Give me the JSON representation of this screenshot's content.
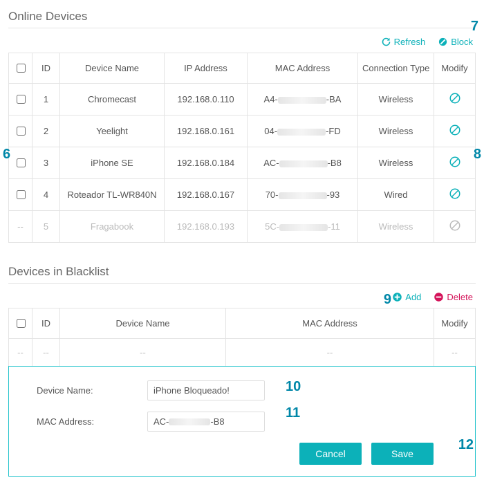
{
  "sections": {
    "online_title": "Online Devices",
    "blacklist_title": "Devices in Blacklist"
  },
  "toolbar_online": {
    "refresh": "Refresh",
    "block": "Block"
  },
  "toolbar_blacklist": {
    "add": "Add",
    "delete": "Delete"
  },
  "online_headers": {
    "id": "ID",
    "name": "Device Name",
    "ip": "IP Address",
    "mac": "MAC Address",
    "conn": "Connection Type",
    "modify": "Modify"
  },
  "online_rows": [
    {
      "id": "1",
      "name": "Chromecast",
      "ip": "192.168.0.110",
      "mac_p": "A4-",
      "mac_s": "-BA",
      "conn": "Wireless",
      "disabled": false
    },
    {
      "id": "2",
      "name": "Yeelight",
      "ip": "192.168.0.161",
      "mac_p": "04-",
      "mac_s": "-FD",
      "conn": "Wireless",
      "disabled": false
    },
    {
      "id": "3",
      "name": "iPhone SE",
      "ip": "192.168.0.184",
      "mac_p": "AC-",
      "mac_s": "-B8",
      "conn": "Wireless",
      "disabled": false
    },
    {
      "id": "4",
      "name": "Roteador TL-WR840N",
      "ip": "192.168.0.167",
      "mac_p": "70-",
      "mac_s": "-93",
      "conn": "Wired",
      "disabled": false
    },
    {
      "id": "5",
      "name": "Fragabook",
      "ip": "192.168.0.193",
      "mac_p": "5C-",
      "mac_s": "-11",
      "conn": "Wireless",
      "disabled": true
    }
  ],
  "blacklist_headers": {
    "id": "ID",
    "name": "Device Name",
    "mac": "MAC Address",
    "modify": "Modify"
  },
  "blacklist_placeholder": "--",
  "form": {
    "name_label": "Device Name:",
    "mac_label": "MAC Address:",
    "name_value": "iPhone Bloqueado!",
    "mac_prefix": "AC-",
    "mac_suffix": "-B8",
    "cancel": "Cancel",
    "save": "Save"
  },
  "annots": {
    "a6": "6",
    "a7": "7",
    "a8": "8",
    "a9": "9",
    "a10": "10",
    "a11": "11",
    "a12": "12"
  }
}
